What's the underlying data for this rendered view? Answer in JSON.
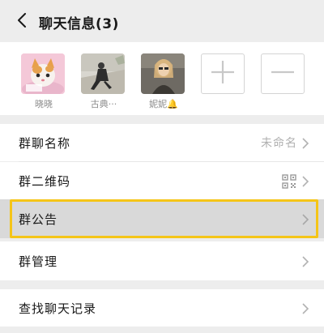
{
  "header": {
    "title": "聊天信息(3)"
  },
  "members": [
    {
      "name": "晓晓"
    },
    {
      "name": "古典···"
    },
    {
      "name": "妮妮",
      "badge": "🔔"
    }
  ],
  "actions": {
    "add_icon": "plus-icon",
    "remove_icon": "minus-icon"
  },
  "settings": {
    "group_name_label": "群聊名称",
    "group_name_value": "未命名",
    "qr_code_label": "群二维码",
    "announcement_label": "群公告",
    "manage_label": "群管理",
    "search_history_label": "查找聊天记录"
  },
  "colors": {
    "highlight_border": "#f5c518",
    "highlight_bg": "#d9d9d9",
    "page_bg": "#ededed"
  }
}
